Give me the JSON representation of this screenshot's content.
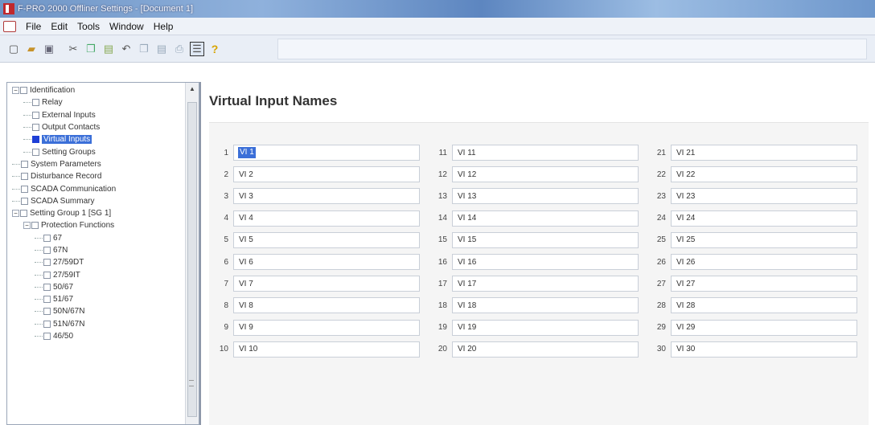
{
  "window": {
    "title": "F-PRO 2000 Offliner Settings - [Document 1]"
  },
  "menu": [
    "File",
    "Edit",
    "Tools",
    "Window",
    "Help"
  ],
  "toolbar": {
    "icons": [
      "new-file-icon",
      "open-folder-icon",
      "save-icon",
      "cut-icon",
      "copy-icon",
      "paste-icon",
      "undo-icon",
      "copy-alt-icon",
      "paste-alt-icon",
      "print-icon",
      "settings-view-icon",
      "help-icon"
    ]
  },
  "tree": [
    {
      "label": "Identification",
      "level": 0,
      "expander": "−",
      "checked": false
    },
    {
      "label": "Relay",
      "level": 1,
      "checked": false
    },
    {
      "label": "External Inputs",
      "level": 1,
      "checked": false
    },
    {
      "label": "Output Contacts",
      "level": 1,
      "checked": false
    },
    {
      "label": "Virtual Inputs",
      "level": 1,
      "checked": true,
      "selected": true
    },
    {
      "label": "Setting Groups",
      "level": 1,
      "checked": false
    },
    {
      "label": "System Parameters",
      "level": 0,
      "checked": false
    },
    {
      "label": "Disturbance Record",
      "level": 0,
      "checked": false
    },
    {
      "label": "SCADA Communication",
      "level": 0,
      "checked": false
    },
    {
      "label": "SCADA Summary",
      "level": 0,
      "checked": false
    },
    {
      "label": "Setting Group 1 [SG 1]",
      "level": 0,
      "expander": "−",
      "checked": false
    },
    {
      "label": "Protection Functions",
      "level": 1,
      "expander": "−",
      "checked": false
    },
    {
      "label": "67",
      "level": 2,
      "checked": false
    },
    {
      "label": "67N",
      "level": 2,
      "checked": false
    },
    {
      "label": "27/59DT",
      "level": 2,
      "checked": false
    },
    {
      "label": "27/59IT",
      "level": 2,
      "checked": false
    },
    {
      "label": "50/67",
      "level": 2,
      "checked": false
    },
    {
      "label": "51/67",
      "level": 2,
      "checked": false
    },
    {
      "label": "50N/67N",
      "level": 2,
      "checked": false
    },
    {
      "label": "51N/67N",
      "level": 2,
      "checked": false
    },
    {
      "label": "46/50",
      "level": 2,
      "checked": false
    }
  ],
  "main": {
    "title": "Virtual Input Names",
    "inputs": [
      {
        "n": "1",
        "v": "VI 1"
      },
      {
        "n": "2",
        "v": "VI 2"
      },
      {
        "n": "3",
        "v": "VI 3"
      },
      {
        "n": "4",
        "v": "VI 4"
      },
      {
        "n": "5",
        "v": "VI 5"
      },
      {
        "n": "6",
        "v": "VI 6"
      },
      {
        "n": "7",
        "v": "VI 7"
      },
      {
        "n": "8",
        "v": "VI 8"
      },
      {
        "n": "9",
        "v": "VI 9"
      },
      {
        "n": "10",
        "v": "VI 10"
      },
      {
        "n": "11",
        "v": "VI 11"
      },
      {
        "n": "12",
        "v": "VI 12"
      },
      {
        "n": "13",
        "v": "VI 13"
      },
      {
        "n": "14",
        "v": "VI 14"
      },
      {
        "n": "15",
        "v": "VI 15"
      },
      {
        "n": "16",
        "v": "VI 16"
      },
      {
        "n": "17",
        "v": "VI 17"
      },
      {
        "n": "18",
        "v": "VI 18"
      },
      {
        "n": "19",
        "v": "VI 19"
      },
      {
        "n": "20",
        "v": "VI 20"
      },
      {
        "n": "21",
        "v": "VI 21"
      },
      {
        "n": "22",
        "v": "VI 22"
      },
      {
        "n": "23",
        "v": "VI 23"
      },
      {
        "n": "24",
        "v": "VI 24"
      },
      {
        "n": "25",
        "v": "VI 25"
      },
      {
        "n": "26",
        "v": "VI 26"
      },
      {
        "n": "27",
        "v": "VI 27"
      },
      {
        "n": "28",
        "v": "VI 28"
      },
      {
        "n": "29",
        "v": "VI 29"
      },
      {
        "n": "30",
        "v": "VI 30"
      }
    ]
  }
}
